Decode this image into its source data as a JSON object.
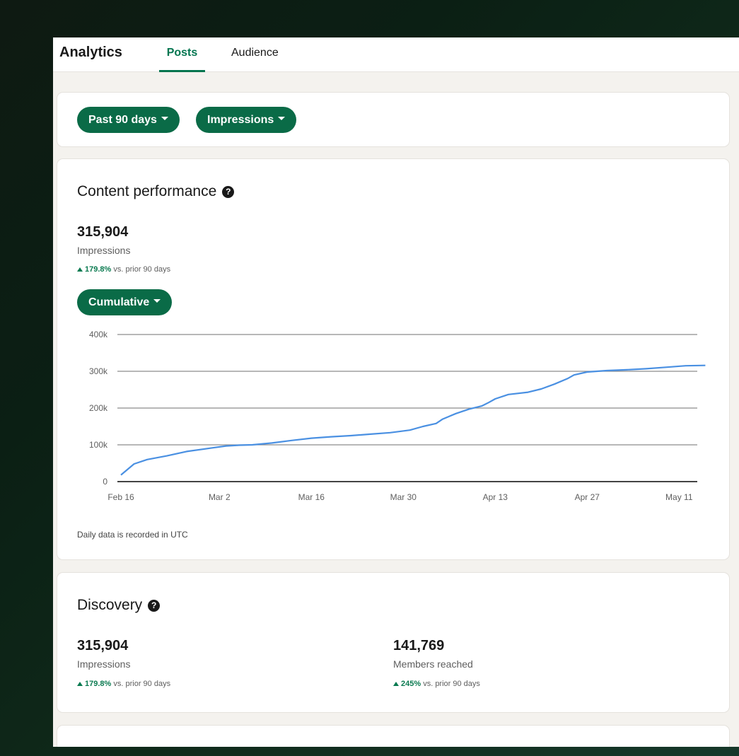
{
  "header": {
    "title": "Analytics",
    "tabs": [
      {
        "label": "Posts",
        "active": true
      },
      {
        "label": "Audience",
        "active": false
      }
    ]
  },
  "filters": {
    "date_range": "Past 90 days",
    "metric": "Impressions"
  },
  "content_performance": {
    "title": "Content performance",
    "help_icon": "question-circle-icon",
    "value": "315,904",
    "label": "Impressions",
    "delta_pct": "179.8%",
    "delta_text": "vs. prior 90 days",
    "mode": "Cumulative",
    "footnote": "Daily data is recorded in UTC"
  },
  "chart_data": {
    "type": "line",
    "x_tick_labels": [
      "Feb 16",
      "Mar 2",
      "Mar 16",
      "Mar 30",
      "Apr 13",
      "Apr 27",
      "May 11"
    ],
    "y_tick_labels": [
      "0",
      "100k",
      "200k",
      "300k",
      "400k"
    ],
    "ylim": [
      0,
      400000
    ],
    "grid": true,
    "series": [
      {
        "color": "#4a90e2",
        "x": [
          "Feb 16",
          "Feb 18",
          "Feb 20",
          "Feb 23",
          "Feb 26",
          "Mar 1",
          "Mar 3",
          "Mar 5",
          "Mar 7",
          "Mar 10",
          "Mar 13",
          "Mar 16",
          "Mar 19",
          "Mar 22",
          "Mar 25",
          "Mar 28",
          "Mar 31",
          "Apr 2",
          "Apr 4",
          "Apr 5",
          "Apr 7",
          "Apr 9",
          "Apr 11",
          "Apr 12",
          "Apr 13",
          "Apr 15",
          "Apr 18",
          "Apr 20",
          "Apr 22",
          "Apr 24",
          "Apr 25",
          "Apr 27",
          "Apr 30",
          "May 3",
          "May 6",
          "May 9",
          "May 12",
          "May 15"
        ],
        "values": [
          18000,
          48000,
          60000,
          70000,
          82000,
          92000,
          97000,
          99000,
          100000,
          105000,
          112000,
          118000,
          122000,
          125000,
          129000,
          133000,
          140000,
          150000,
          158000,
          170000,
          185000,
          197000,
          206000,
          215000,
          225000,
          237000,
          243000,
          252000,
          265000,
          280000,
          290000,
          298000,
          302000,
          304000,
          307000,
          311000,
          315000,
          315904
        ]
      }
    ]
  },
  "discovery": {
    "title": "Discovery",
    "help_icon": "question-circle-icon",
    "metrics": [
      {
        "value": "315,904",
        "label": "Impressions",
        "delta_pct": "179.8%",
        "delta_text": "vs. prior 90 days"
      },
      {
        "value": "141,769",
        "label": "Members reached",
        "delta_pct": "245%",
        "delta_text": "vs. prior 90 days"
      }
    ]
  },
  "colors": {
    "accent": "#0a6b47",
    "line": "#4a90e2",
    "positive": "#0a7a50"
  }
}
